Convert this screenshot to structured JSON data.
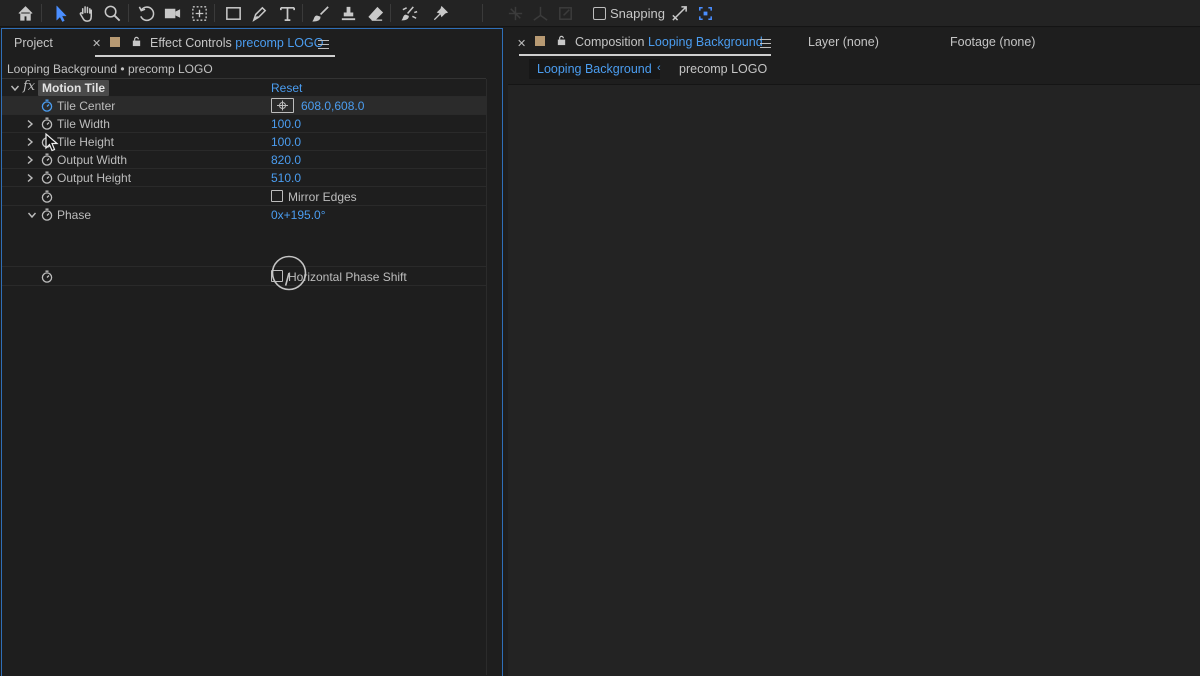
{
  "toolbar": {
    "icons": [
      "home-icon",
      "selection-tool-icon",
      "hand-tool-icon",
      "zoom-tool-icon",
      "rotate-tool-icon",
      "camera-tool-icon",
      "pan-behind-tool-icon",
      "rectangle-tool-icon",
      "pen-tool-icon",
      "type-tool-icon",
      "brush-tool-icon",
      "clone-stamp-tool-icon",
      "eraser-tool-icon",
      "roto-brush-tool-icon",
      "puppet-pin-tool-icon"
    ],
    "active_tool": "selection-tool-icon",
    "snapping_label": "Snapping"
  },
  "left_panel": {
    "project_tab": "Project",
    "effect_controls_tab_prefix": "Effect Controls",
    "effect_controls_tab_layer": "precomp LOGO",
    "layer_path": "Looping Background • precomp LOGO",
    "effect": {
      "fx_label": "fx",
      "name": "Motion Tile",
      "reset_label": "Reset"
    },
    "properties": [
      {
        "label": "Tile Center",
        "value": "608.0,608.0"
      },
      {
        "label": "Tile Width",
        "value": "100.0"
      },
      {
        "label": "Tile Height",
        "value": "100.0"
      },
      {
        "label": "Output Width",
        "value": "820.0"
      },
      {
        "label": "Output Height",
        "value": "510.0"
      },
      {
        "label": "",
        "value": "Mirror Edges"
      },
      {
        "label": "Phase",
        "value": "0x+195.0°"
      },
      {
        "label": "",
        "value": "Horizontal Phase Shift"
      }
    ],
    "mirror_edges_checked": false,
    "horizontal_phase_shift_checked": false,
    "phase_angle_degrees": 195
  },
  "right_panel": {
    "composition_tab_prefix": "Composition",
    "composition_tab_name": "Looping Background",
    "layer_tab": "Layer (none)",
    "footage_tab": "Footage (none)",
    "breadcrumb_active": "Looping Background",
    "breadcrumb_next": "precomp LOGO"
  },
  "colors": {
    "accent": "#4b9df0",
    "panel_focus_border": "#2f6fb8",
    "label_swatch": "#b89a73"
  }
}
